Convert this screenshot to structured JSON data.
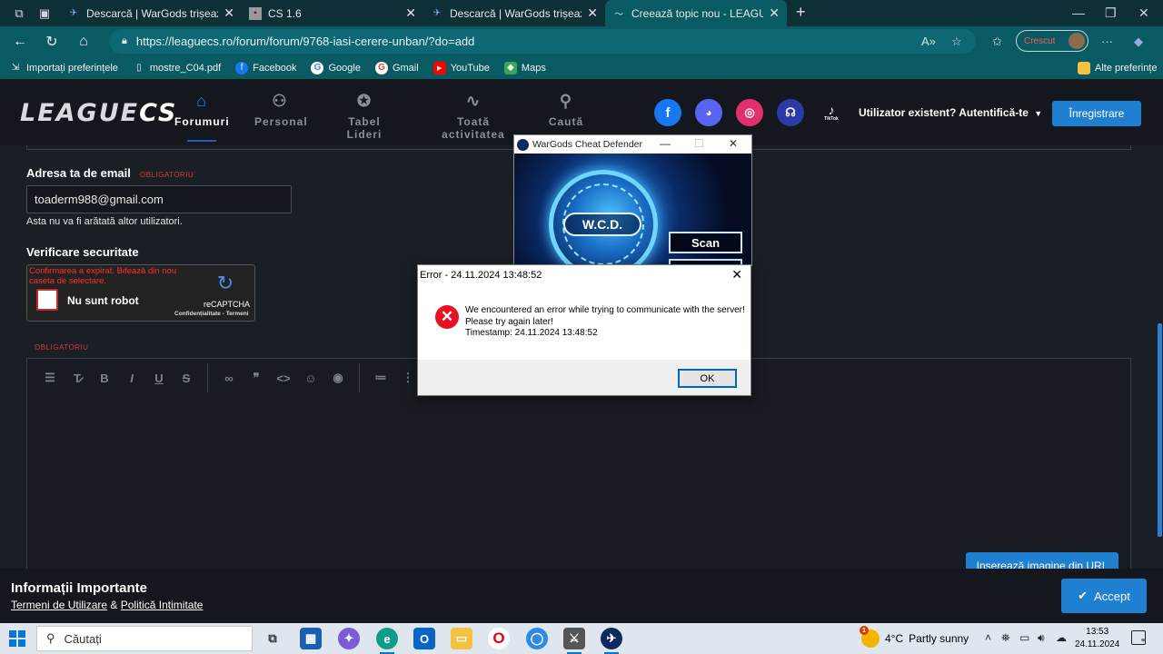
{
  "browser": {
    "tabs": [
      {
        "label": "Descarcă | WarGods trișează apăr",
        "favicon": "wargods-icon",
        "active": false
      },
      {
        "label": "CS 1.6",
        "favicon": "cs-icon",
        "active": false
      },
      {
        "label": "Descarcă | WarGods trișează apăr",
        "favicon": "wargods-icon",
        "active": false
      },
      {
        "label": "Creează topic nou - LEAGUECS RO",
        "favicon": "leaguecs-icon",
        "active": true
      }
    ],
    "url": "https://leaguecs.ro/forum/forum/9768-iasi-cerere-unban/?do=add",
    "profile_label": "Crescut",
    "favorites": [
      {
        "label": "Importați preferințele",
        "icon": "import-icon"
      },
      {
        "label": "mostre_C04.pdf",
        "icon": "file-icon"
      },
      {
        "label": "Facebook",
        "icon": "facebook-icon"
      },
      {
        "label": "Google",
        "icon": "google-icon"
      },
      {
        "label": "Gmail",
        "icon": "gmail-icon"
      },
      {
        "label": "YouTube",
        "icon": "youtube-icon"
      },
      {
        "label": "Maps",
        "icon": "maps-icon"
      }
    ],
    "other_favorites": "Alte preferințe"
  },
  "site": {
    "logo_main": "LEAGUE",
    "logo_accent": "CS",
    "nav": [
      {
        "label": "Forumuri",
        "icon": "home-icon",
        "active": true
      },
      {
        "label": "Personal",
        "icon": "people-icon",
        "active": false
      },
      {
        "label": "Tabel Lideri",
        "icon": "award-icon",
        "active": false
      },
      {
        "label": "Toată activitatea",
        "icon": "activity-icon",
        "active": false
      },
      {
        "label": "Caută",
        "icon": "search-icon",
        "active": false
      }
    ],
    "tiktok_label": "TikTok",
    "login_label": "Utilizator existent? Autentifică-te",
    "register_label": "Înregistrare"
  },
  "form": {
    "email_label": "Adresa ta de email",
    "required": "OBLIGATORIU",
    "email_value": "toaderm988@gmail.com",
    "email_help": "Asta nu va fi arătată altor utilizatori.",
    "security_label": "Verificare securitate",
    "captcha_error": "Confirmarea a expirat. Bifează din nou caseta de selectare.",
    "captcha_label": "Nu sunt robot",
    "captcha_brand": "reCAPTCHA",
    "captcha_privacy": "Confidențialitate - Termeni",
    "insert_image_label": "Inserează imagine din URL"
  },
  "infobar": {
    "title": "Informații Importante",
    "terms": "Termeni de Utilizare",
    "amp": "&",
    "privacy": "Politică Intimitate",
    "accept": "Accept"
  },
  "wcd": {
    "title": "WarGods Cheat Defender",
    "logo": "W.C.D.",
    "scan": "Scan"
  },
  "error": {
    "title": "Error - 24.11.2024 13:48:52",
    "line1": "We encountered an error while trying to communicate with the server!",
    "line2": "Please try again later!",
    "line3": "Timestamp: 24.11.2024 13:48:52",
    "ok": "OK"
  },
  "taskbar": {
    "search": "Căutați",
    "weather_temp": "4°C",
    "weather_desc": "Partly sunny",
    "weather_badge": "1",
    "time": "13:53",
    "date": "24.11.2024"
  }
}
